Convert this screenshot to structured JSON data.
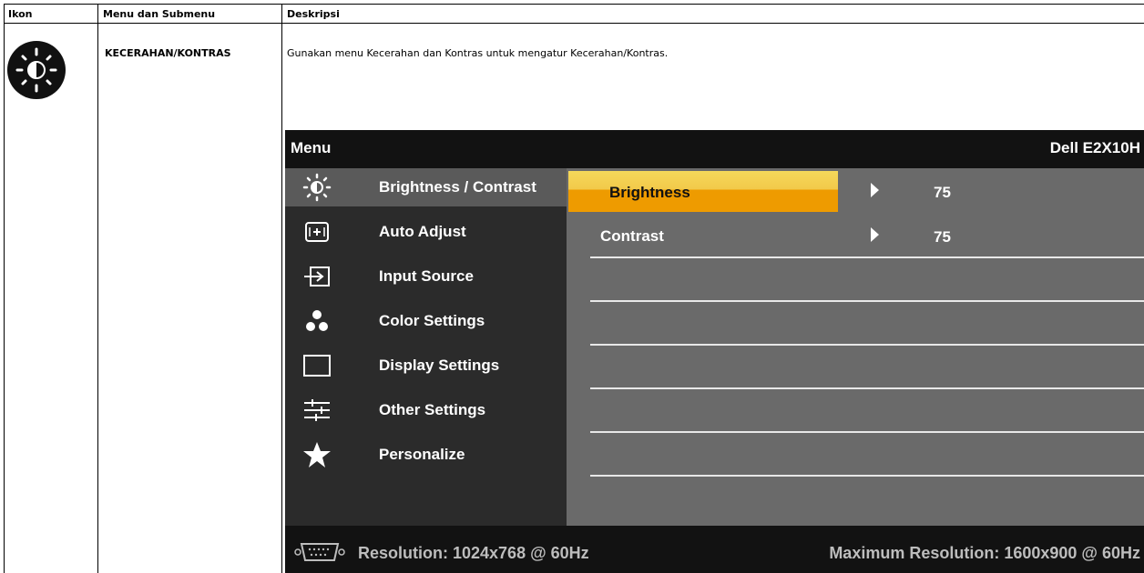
{
  "table": {
    "headers": [
      "Ikon",
      "Menu dan Submenu",
      "Deskripsi"
    ],
    "row": {
      "icon": "brightness-contrast-icon",
      "menu": "KECERAHAN/KONTRAS",
      "description": "Gunakan menu Kecerahan dan Kontras untuk mengatur Kecerahan/Kontras."
    }
  },
  "osd": {
    "title": "Menu",
    "model": "Dell E2X10H",
    "menu_items": [
      {
        "label": "Brightness / Contrast",
        "icon": "brightness-icon",
        "active": true
      },
      {
        "label": "Auto Adjust",
        "icon": "auto-adjust-icon"
      },
      {
        "label": "Input Source",
        "icon": "input-source-icon"
      },
      {
        "label": "Color Settings",
        "icon": "color-settings-icon"
      },
      {
        "label": "Display Settings",
        "icon": "display-settings-icon"
      },
      {
        "label": "Other Settings",
        "icon": "other-settings-icon"
      },
      {
        "label": "Personalize",
        "icon": "star-icon"
      }
    ],
    "submenu": [
      {
        "label": "Brightness",
        "value": "75",
        "selected": true
      },
      {
        "label": "Contrast",
        "value": "75"
      }
    ],
    "footer": {
      "resolution": "Resolution: 1024x768 @ 60Hz",
      "max_resolution": "Maximum Resolution: 1600x900 @ 60Hz",
      "connector_icon": "vga-connector-icon"
    },
    "colors": {
      "highlight": "#ee9b00",
      "highlight_top": "#f5d85a",
      "panel_left": "#2b2b2b",
      "panel_right": "#6a6a6a",
      "background": "#121212"
    }
  }
}
